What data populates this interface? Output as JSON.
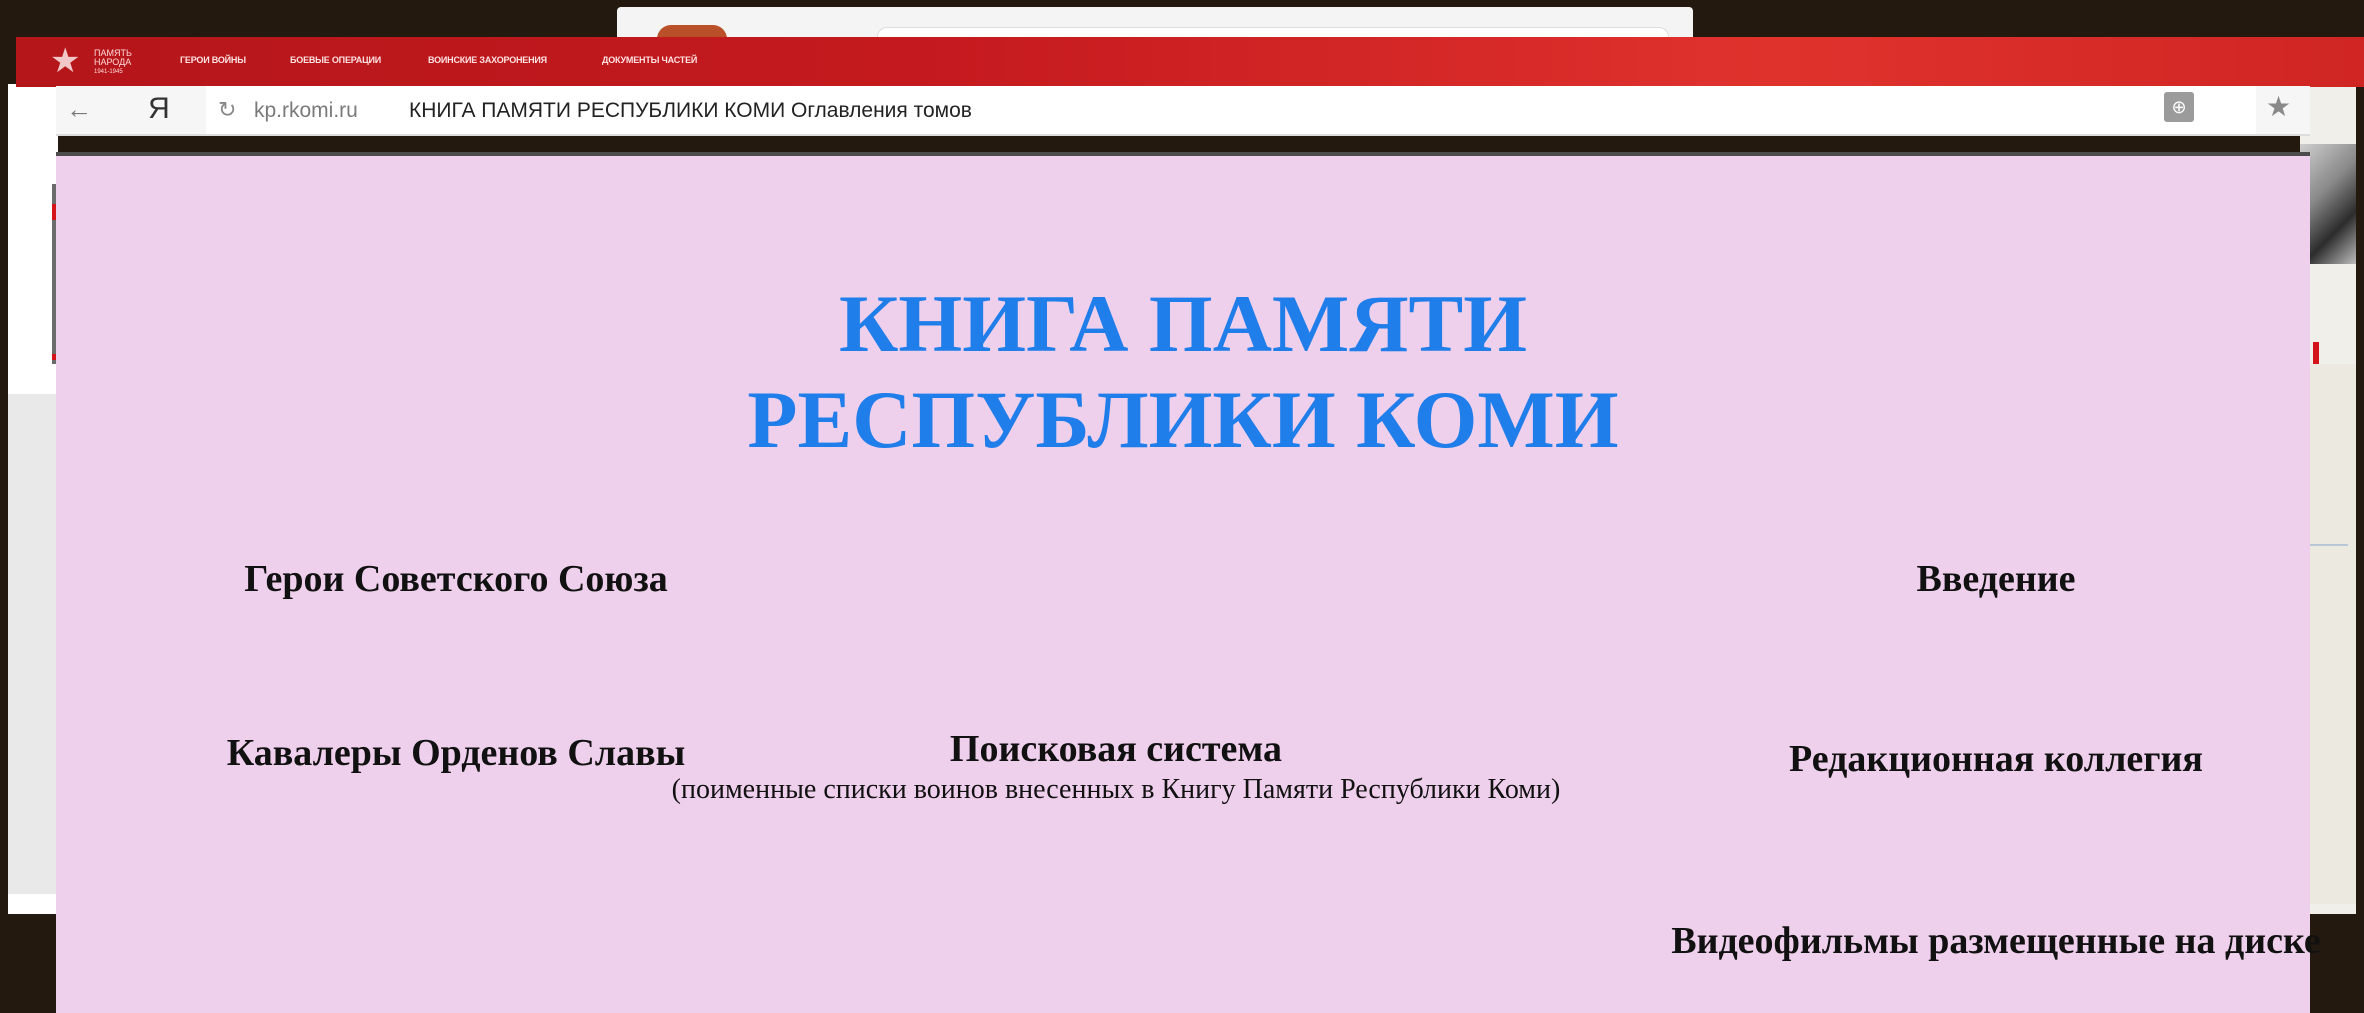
{
  "site_nav": {
    "logo": {
      "line1": "ПАМЯТЬ",
      "line2": "НАРОДА",
      "line3": "1941-1945"
    },
    "links": [
      "ГЕРОИ ВОЙНЫ",
      "БОЕВЫЕ ОПЕРАЦИИ",
      "ВОИНСКИЕ ЗАХОРОНЕНИЯ",
      "ДОКУМЕНТЫ ЧАСТЕЙ"
    ]
  },
  "browser": {
    "back_glyph": "←",
    "yandex_glyph": "Я",
    "reload_glyph": "↻",
    "url_domain": "kp.rkomi.ru",
    "url_title": "КНИГА ПАМЯТИ РЕСПУБЛИКИ КОМИ Оглавления томов",
    "globe_glyph": "⊕",
    "bookmark_glyph": "★"
  },
  "page": {
    "title_line1": "КНИГА ПАМЯТИ",
    "title_line2": "РЕСПУБЛИКИ КОМИ",
    "title_color": "#1f7eea",
    "background_color": "#efd0ec",
    "links": {
      "heroes": "Герои Советского Союза",
      "intro": "Введение",
      "cavaliers": "Кавалеры Орденов Славы",
      "search_title": "Поисковая система",
      "search_subtitle": "(поименные списки воинов внесенных в Книгу Памяти Республики Коми)",
      "editorial": "Редакционная коллегия",
      "videos": "Видеофильмы размещенные на диске"
    }
  }
}
